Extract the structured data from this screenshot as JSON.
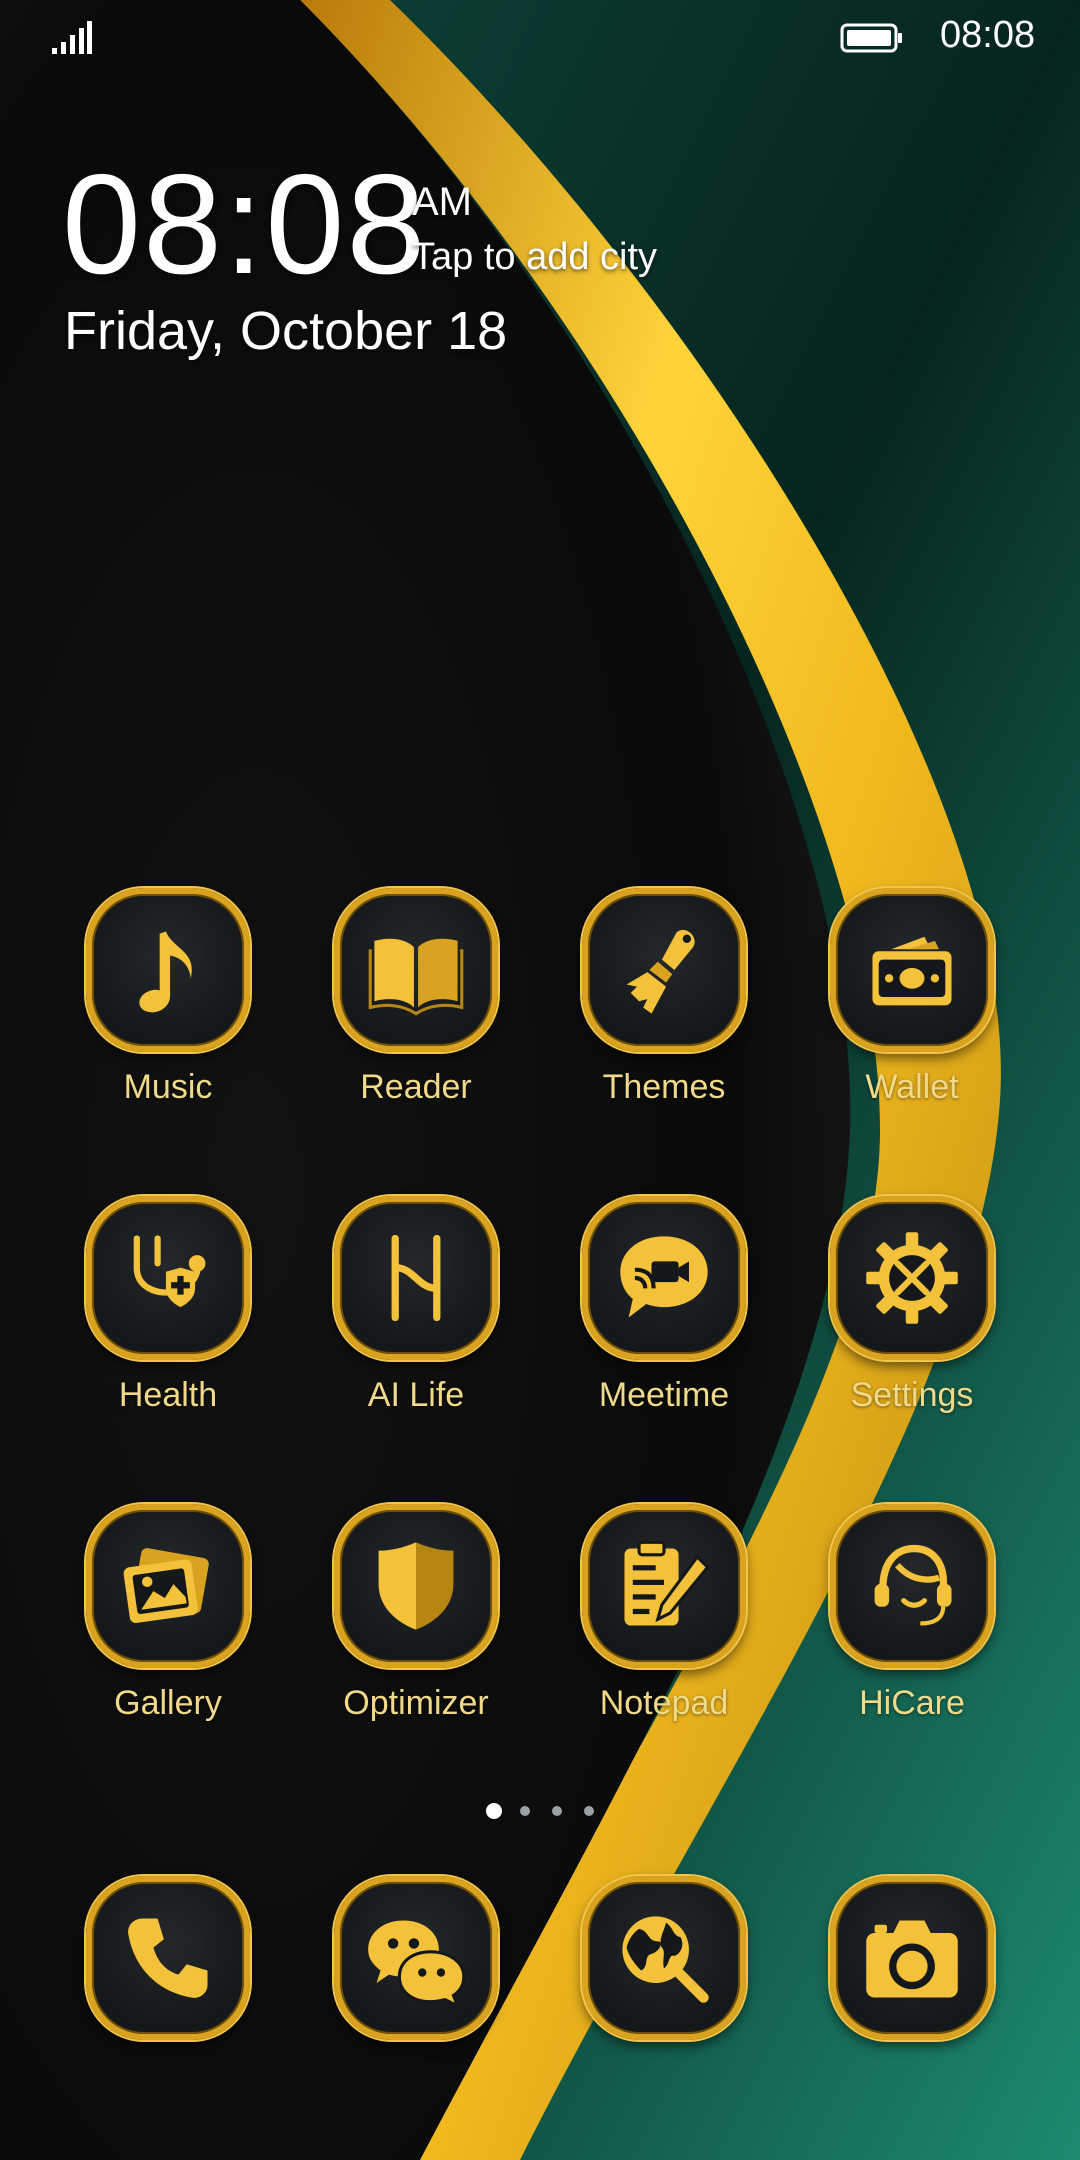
{
  "status_bar": {
    "time": "08:08",
    "signal_icon": "signal-icon",
    "battery_icon": "battery-icon"
  },
  "clock_widget": {
    "time": "08:08",
    "ampm": "AM",
    "city_prompt": "Tap to add city",
    "date": "Friday, October 18"
  },
  "apps": [
    {
      "label": "Music",
      "icon": "music-note-icon"
    },
    {
      "label": "Reader",
      "icon": "book-icon"
    },
    {
      "label": "Themes",
      "icon": "paintbrush-icon"
    },
    {
      "label": "Wallet",
      "icon": "wallet-cash-icon"
    },
    {
      "label": "Health",
      "icon": "stethoscope-shield-icon"
    },
    {
      "label": "AI Life",
      "icon": "ai-life-icon"
    },
    {
      "label": "Meetime",
      "icon": "video-chat-icon"
    },
    {
      "label": "Settings",
      "icon": "gear-tools-icon"
    },
    {
      "label": "Gallery",
      "icon": "photo-stack-icon"
    },
    {
      "label": "Optimizer",
      "icon": "shield-icon"
    },
    {
      "label": "Notepad",
      "icon": "clipboard-pencil-icon"
    },
    {
      "label": "HiCare",
      "icon": "headset-person-icon"
    }
  ],
  "page_indicator": {
    "pages": 4,
    "current": 1
  },
  "dock": [
    {
      "icon": "phone-icon"
    },
    {
      "icon": "chat-bubbles-icon"
    },
    {
      "icon": "globe-search-icon"
    },
    {
      "icon": "camera-icon"
    }
  ],
  "colors": {
    "gold": "#d9a21f",
    "gold_light": "#f6c93c",
    "label": "#f1d98a",
    "green": "#167a63",
    "dark": "#0b0b0b"
  }
}
